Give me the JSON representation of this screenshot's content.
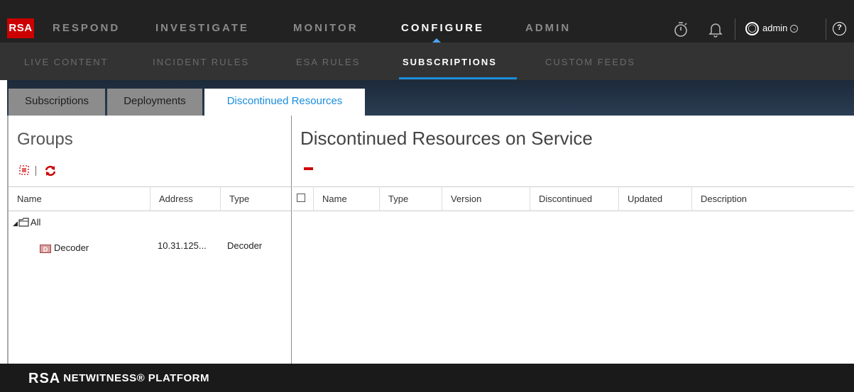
{
  "nav": {
    "brand": "RSA",
    "items": [
      "RESPOND",
      "INVESTIGATE",
      "MONITOR",
      "CONFIGURE",
      "ADMIN"
    ],
    "active": "CONFIGURE",
    "user": "admin",
    "icons": [
      "stopwatch-icon",
      "bell-icon",
      "user-icon",
      "help-icon"
    ]
  },
  "subnav": {
    "items": [
      "LIVE CONTENT",
      "INCIDENT RULES",
      "ESA RULES",
      "SUBSCRIPTIONS",
      "CUSTOM FEEDS"
    ],
    "active": "SUBSCRIPTIONS"
  },
  "tabs": [
    "Subscriptions",
    "Deployments",
    "Discontinued Resources"
  ],
  "active_tab": "Discontinued Resources",
  "groups": {
    "title": "Groups",
    "columns": [
      "Name",
      "Address",
      "Type"
    ],
    "tree": {
      "root": "All",
      "children": [
        {
          "badge": "D",
          "name": "Decoder",
          "address": "10.31.125...",
          "type": "Decoder"
        }
      ]
    }
  },
  "resources": {
    "title": "Discontinued Resources on Service",
    "columns": [
      "Name",
      "Type",
      "Version",
      "Discontinued",
      "Updated",
      "Description"
    ]
  },
  "footer": {
    "logo": "RSA",
    "product": "NETWITNESS® PLATFORM"
  },
  "colors": {
    "accent": "#1a8ddc",
    "brand_red": "#cc0000",
    "topbar": "#222222",
    "subbar": "#333333"
  }
}
